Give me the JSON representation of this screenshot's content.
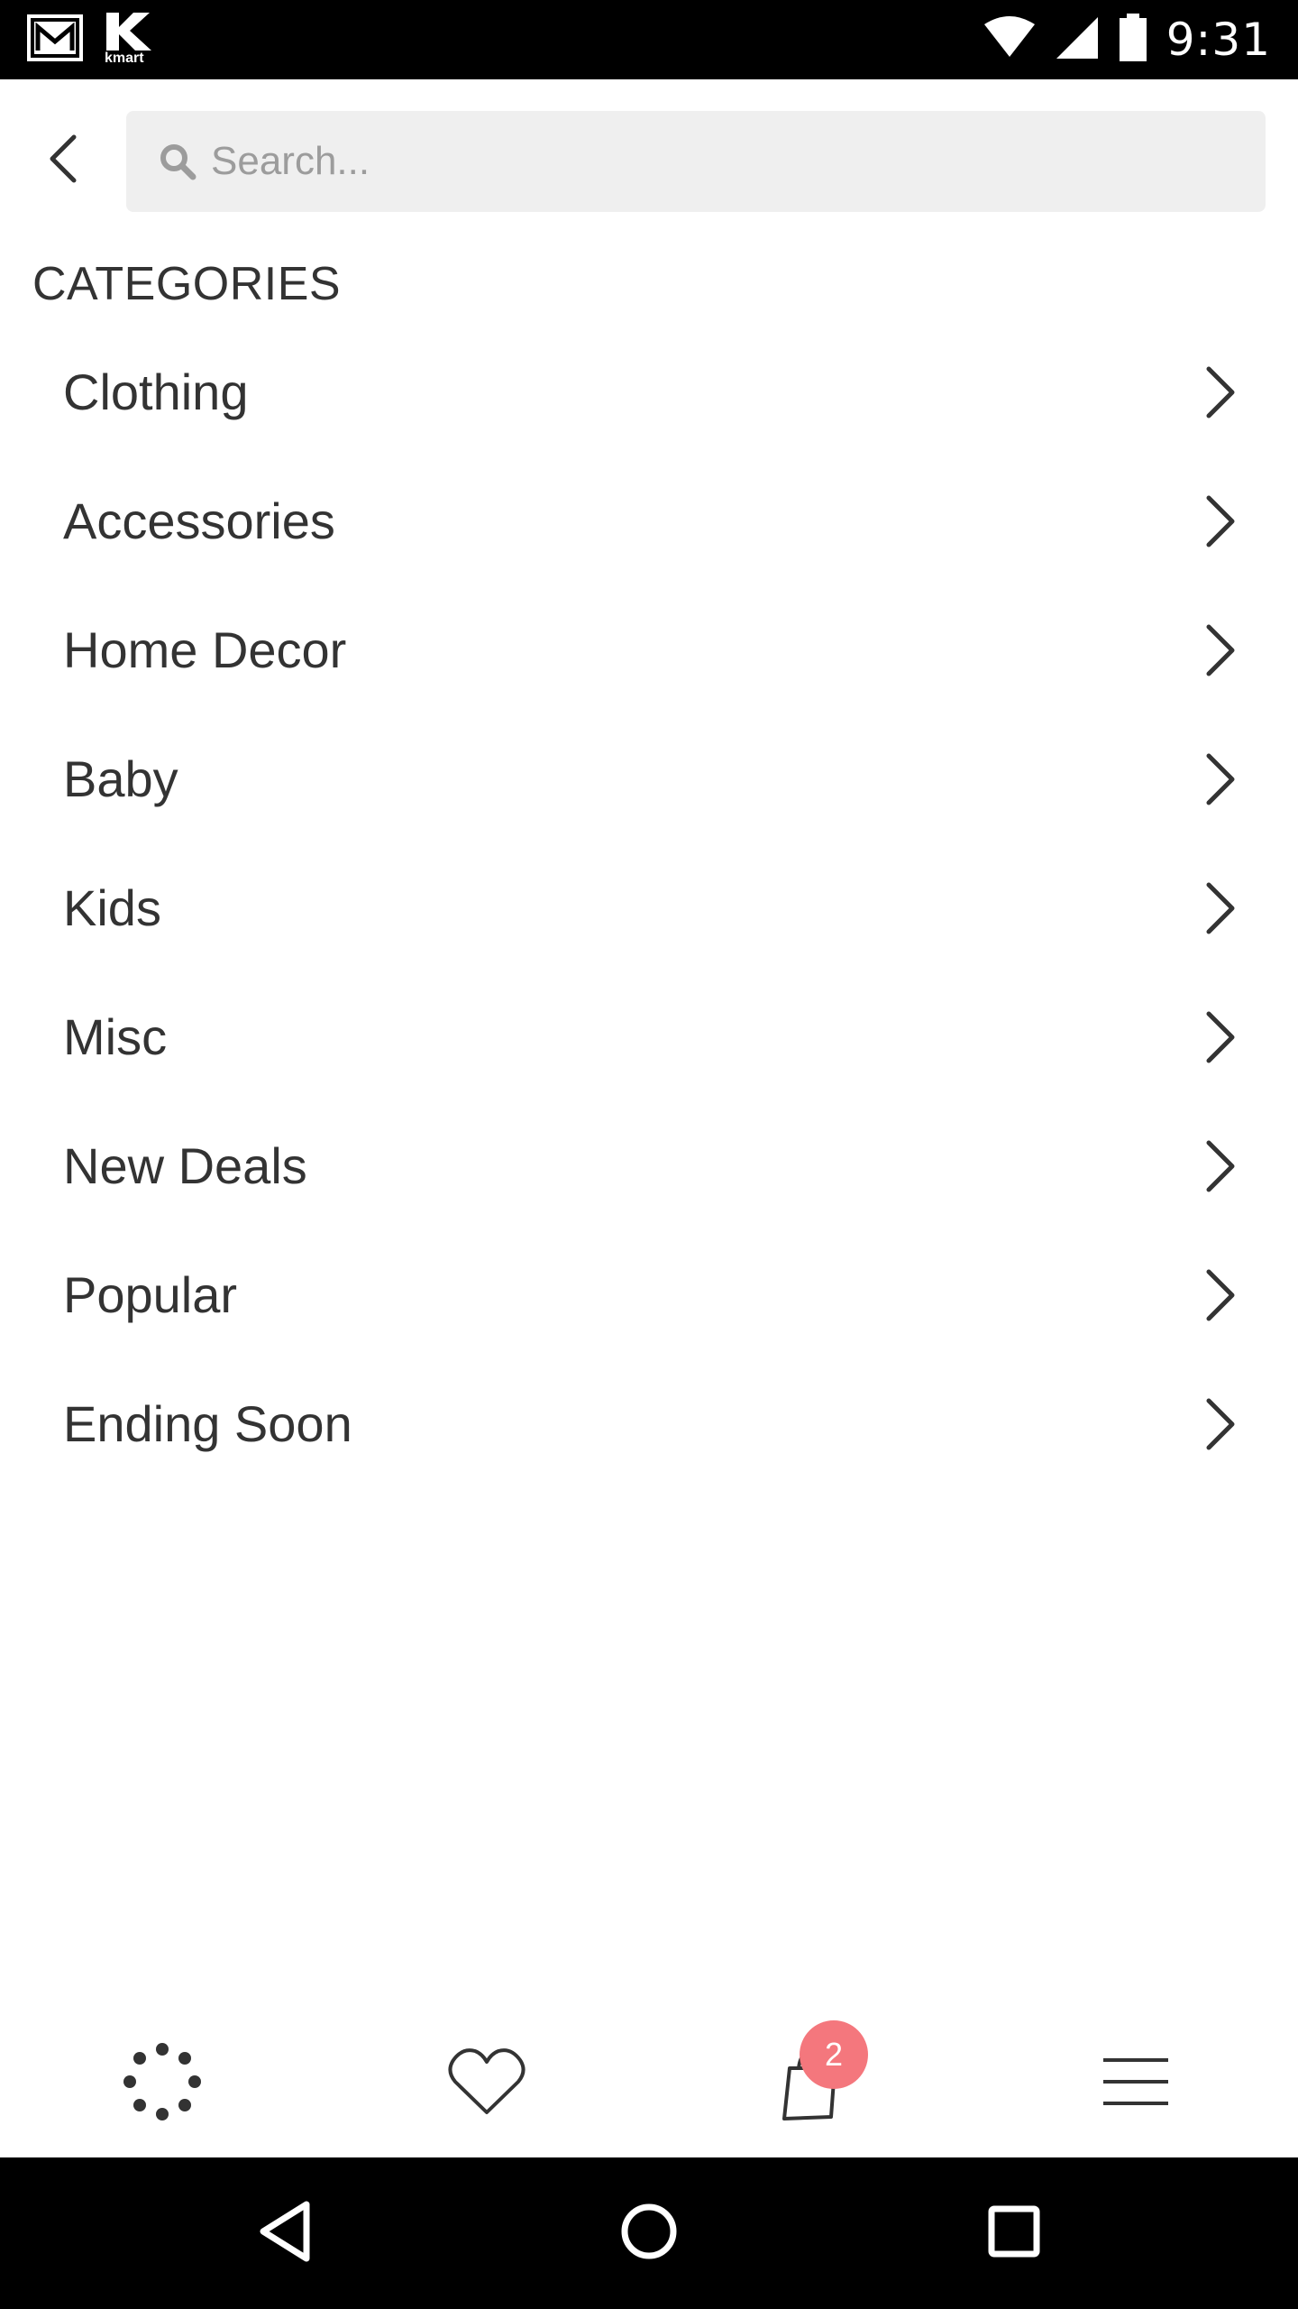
{
  "status_bar": {
    "time": "9:31",
    "app_icons": [
      "gmail-icon",
      "kmart-icon"
    ],
    "kmart_text": "kmart",
    "system_icons": [
      "wifi-icon",
      "signal-icon",
      "battery-icon"
    ]
  },
  "header": {
    "back_icon": "chevron-left-icon",
    "search": {
      "placeholder": "Search...",
      "value": "",
      "icon": "search-icon"
    }
  },
  "categories": {
    "heading": "CATEGORIES",
    "items": [
      {
        "label": "Clothing"
      },
      {
        "label": "Accessories"
      },
      {
        "label": "Home Decor"
      },
      {
        "label": "Baby"
      },
      {
        "label": "Kids"
      },
      {
        "label": "Misc"
      },
      {
        "label": "New Deals"
      },
      {
        "label": "Popular"
      },
      {
        "label": "Ending Soon"
      }
    ]
  },
  "bottom_nav": {
    "items": [
      "dots-circle-icon",
      "heart-icon",
      "shopping-bag-icon",
      "hamburger-menu-icon"
    ],
    "cart_badge_count": "2"
  },
  "android_nav": {
    "items": [
      "back-triangle-icon",
      "home-circle-icon",
      "recents-square-icon"
    ]
  },
  "colors": {
    "text": "#333333",
    "search_bg": "#efefef",
    "placeholder": "#9c9c9c",
    "badge": "#f4777d",
    "system_bar": "#000000"
  }
}
